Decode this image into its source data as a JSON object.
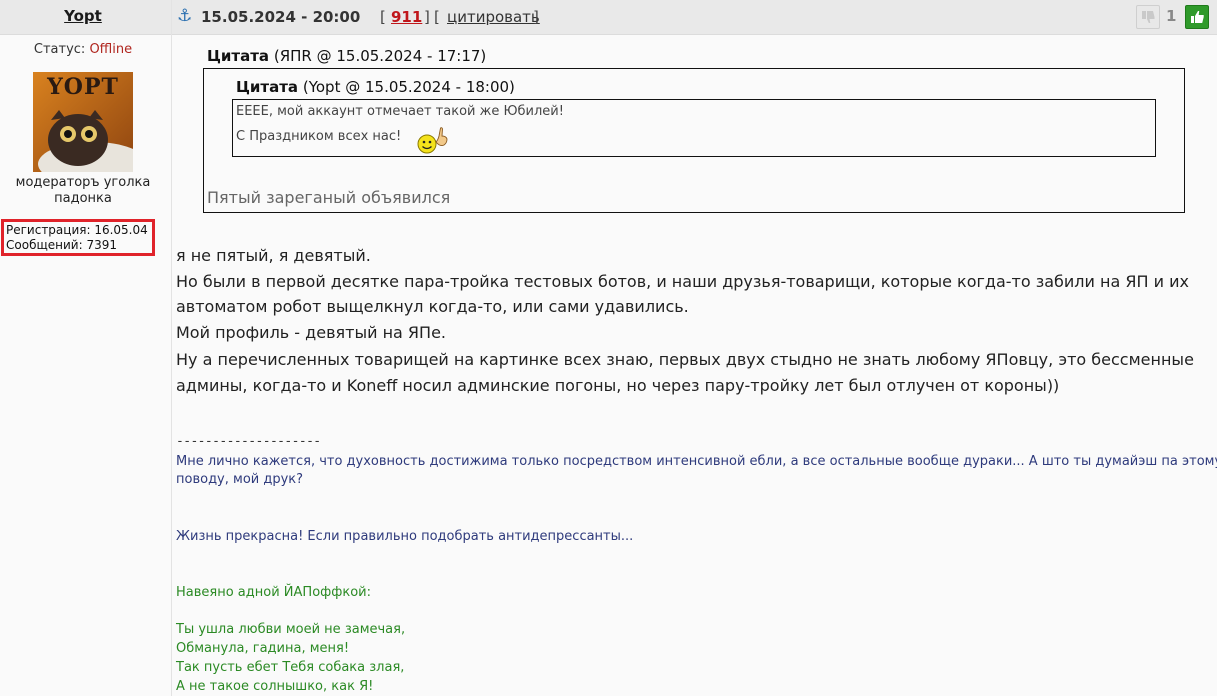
{
  "user": {
    "name": "Yopt",
    "status_label": "Статус:",
    "status_value": "Offline",
    "avatar_text": "YOPT",
    "rank": "модераторъ уголка падонка",
    "registration": "Регистрация: 16.05.04",
    "messages": "Сообщений: 7391"
  },
  "post": {
    "date": "15.05.2024 - 20:00",
    "number": "911",
    "quote_action": "цитировать",
    "rating": "1",
    "bracket_open": "[",
    "bracket_close": "]"
  },
  "quote_outer": {
    "label": "Цитата",
    "meta": "(ЯПR @ 15.05.2024 - 17:17)",
    "text": "Пятый зареганый объявился"
  },
  "quote_inner": {
    "label": "Цитата",
    "meta": "(Yopt @ 15.05.2024 - 18:00)",
    "line1": "ЕЕЕЕ, мой аккаунт отмечает такой же Юбилей!",
    "line2": "С Праздником всех нас!"
  },
  "body": [
    "я не пятый, я девятый.",
    "Но были в первой десятке пара-тройка тестовых ботов, и наши друзья-товарищи, которые когда-то забили на ЯП и их",
    "автоматом робот выщелкнул когда-то, или сами удавились.",
    "Мой профиль - девятый на ЯПе.",
    "Ну а перечисленных товарищей на картинке всех знаю, первых двух стыдно не знать любому ЯПовцу, это бессменные",
    "админы, когда-то и Koneff носил админские погоны, но через пару-тройку лет был отлучен от короны))"
  ],
  "signature": {
    "separator": "--------------------",
    "line1": "Мне лично кажется, что духовность достижима только посредством интенсивной ебли, а все остальные вообще дураки... А што ты думайэш па этому",
    "line2": "поводу, мой друк?",
    "line3": "Жизнь прекрасна! Если правильно подобрать антидепрессанты...",
    "line4": "Навеяно адной ЙАПоффкой:",
    "poem": [
      "Ты ушла любви моей не замечая,",
      "Обманула, гадина, меня!",
      "Так пусть ебет Тебя собака злая,",
      "А не такое солнышко, как Я!"
    ]
  },
  "colors": {
    "header_bg": "#e9e9e9",
    "post_number": "#c0161b",
    "offline": "#b0261f",
    "highlight_box": "#e0232a",
    "signature_navy": "#2e3a7c",
    "signature_green": "#2b8a24",
    "thumb_up": "#2f9a2a"
  },
  "icons": {
    "anchor": "anchor-icon",
    "thumb_down": "thumb-down-icon",
    "thumb_up": "thumb-up-icon",
    "smiley": "pointing-smiley-icon"
  }
}
